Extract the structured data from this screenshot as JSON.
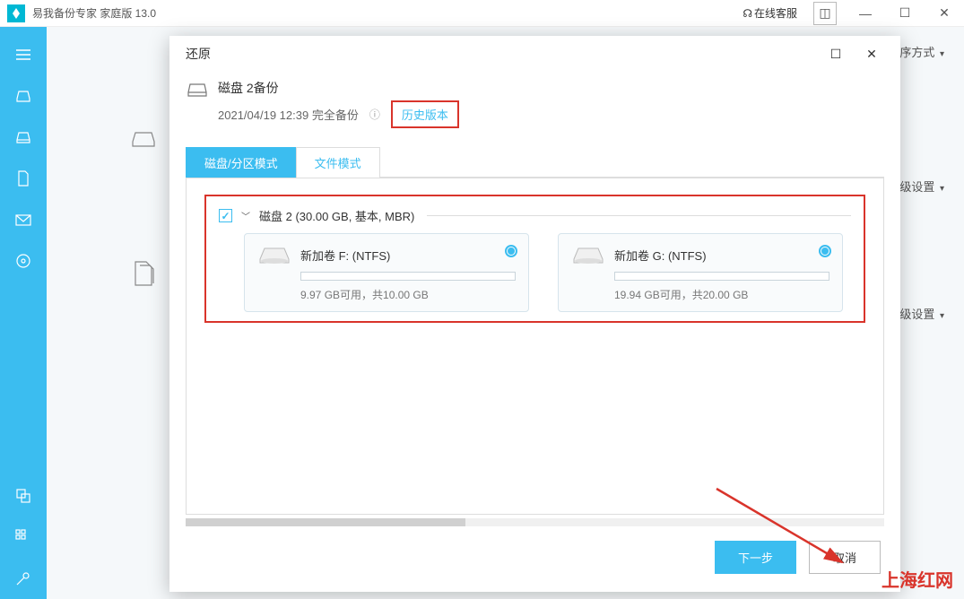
{
  "app": {
    "title": "易我备份专家 家庭版 13.0",
    "support": "在线客服"
  },
  "toolbar": {
    "sort": "排序方式"
  },
  "bg": {
    "advanced": "高级设置"
  },
  "dialog": {
    "title": "还原",
    "backup_name": "磁盘 2备份",
    "backup_time": "2021/04/19 12:39 完全备份",
    "history_link": "历史版本",
    "tab_disk": "磁盘/分区模式",
    "tab_file": "文件模式",
    "disk_group": "磁盘 2 (30.00 GB, 基本, MBR)",
    "partitions": [
      {
        "name": "新加卷 F: (NTFS)",
        "usage": "9.97 GB可用，共10.00 GB"
      },
      {
        "name": "新加卷 G: (NTFS)",
        "usage": "19.94 GB可用，共20.00 GB"
      }
    ],
    "next": "下一步",
    "cancel": "取消"
  },
  "watermark": "上海红网"
}
